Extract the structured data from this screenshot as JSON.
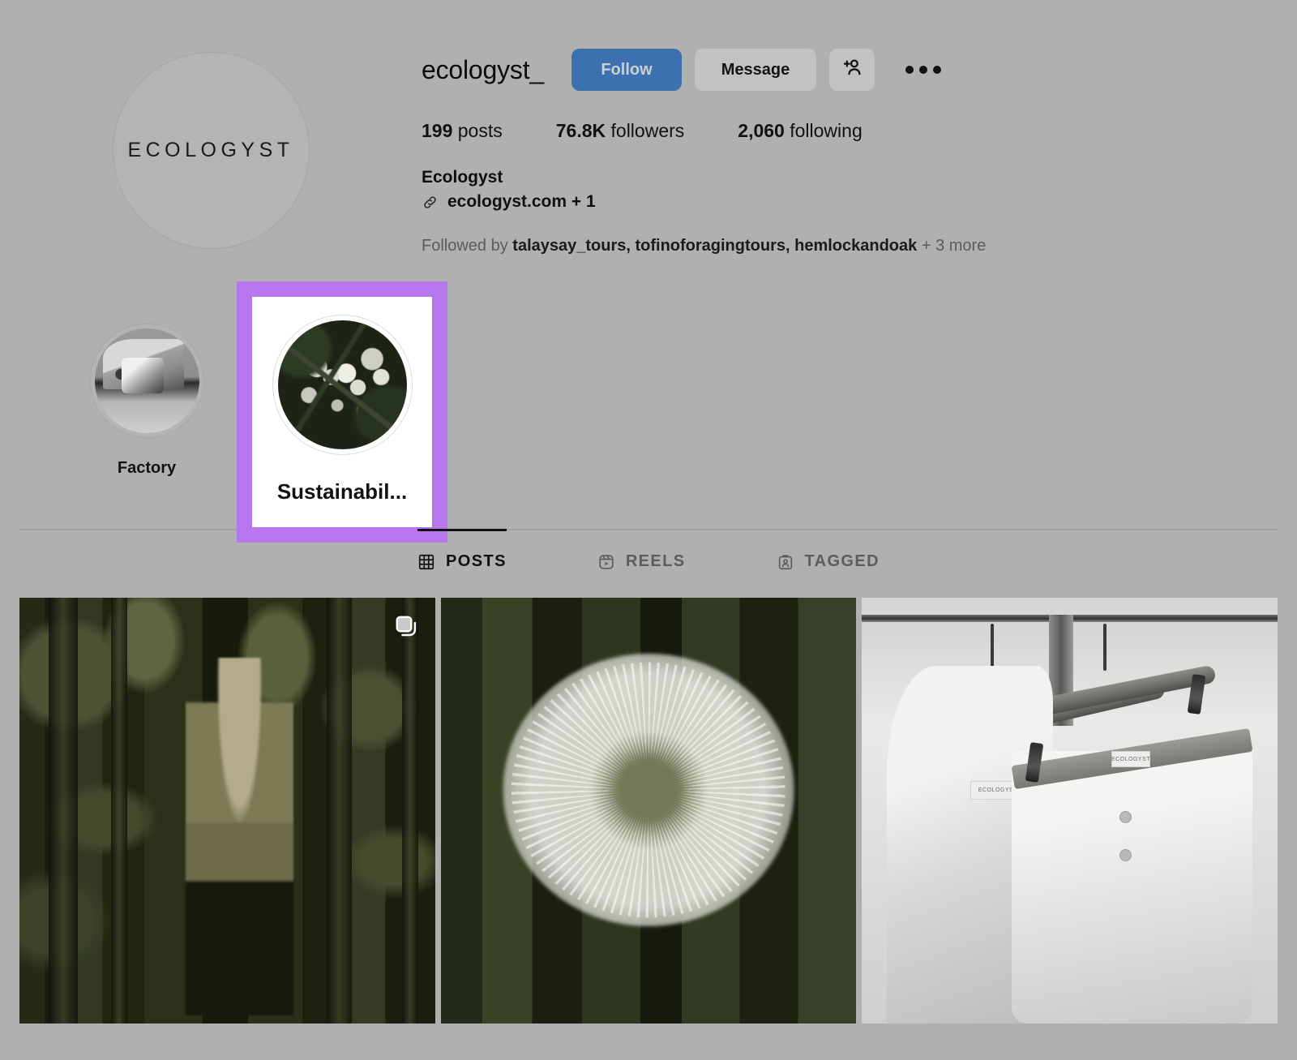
{
  "theme": {
    "page_bg": "#b0b0b0",
    "follow_button_bg": "#3b71b0",
    "secondary_button_bg": "#c2c2c2",
    "highlight_selection_purple": "#b576ee",
    "active_tab_underline": "#111111"
  },
  "profile": {
    "username": "ecologyst_",
    "avatar_wordmark": "ECOLOGYST",
    "actions": {
      "follow_label": "Follow",
      "message_label": "Message",
      "add_person_icon": "person-add-icon",
      "more_options_icon": "more-options-icon"
    },
    "stats": [
      {
        "value": "199",
        "label": "posts"
      },
      {
        "value": "76.8K",
        "label": "followers"
      },
      {
        "value": "2,060",
        "label": "following"
      }
    ],
    "bio": {
      "display_name": "Ecologyst",
      "link_icon": "link-icon",
      "link_text": "ecologyst.com + 1"
    },
    "followed_by": {
      "prefix": "Followed by",
      "names": "talaysay_tours, tofinoforagingtours, hemlockandoak",
      "suffix": "+ 3 more"
    }
  },
  "highlights": [
    {
      "label": "Factory",
      "art": "factory",
      "selected": false
    },
    {
      "label": "Sustainabil...",
      "art": "berries",
      "selected": true
    }
  ],
  "tabs": [
    {
      "label": "POSTS",
      "icon": "grid-icon",
      "active": true
    },
    {
      "label": "REELS",
      "icon": "reels-icon",
      "active": false
    },
    {
      "label": "TAGGED",
      "icon": "tagged-icon",
      "active": false
    }
  ],
  "posts": [
    {
      "alt": "Person in jacket standing in dark green forest",
      "art": "forest",
      "badge": "carousel-icon"
    },
    {
      "alt": "Dandelion seedhead close-up on green background",
      "art": "dandelion",
      "badge": ""
    },
    {
      "alt": "White shirt and boxer shorts on wooden hangers",
      "art": "shirts",
      "badge": ""
    }
  ]
}
